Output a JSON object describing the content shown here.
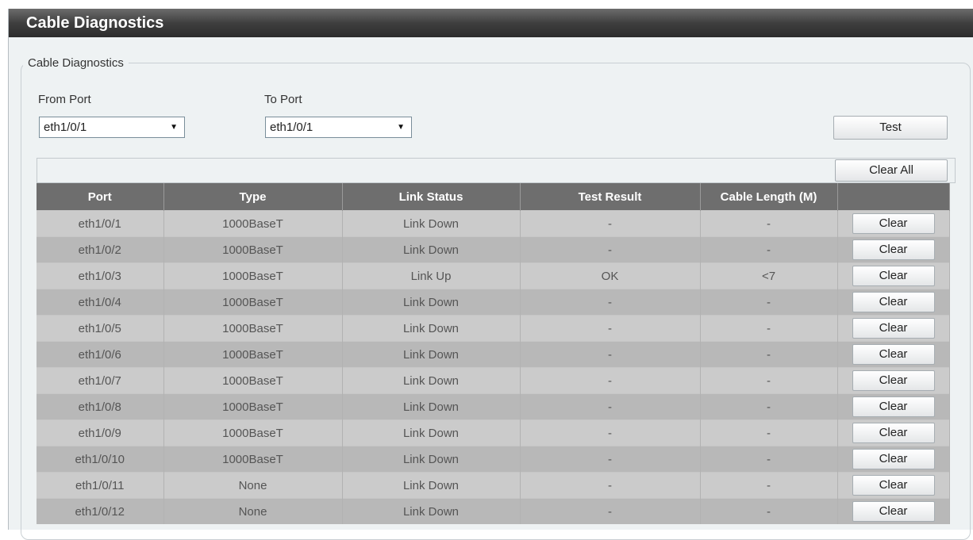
{
  "window": {
    "title": "Cable Diagnostics"
  },
  "group": {
    "legend": "Cable Diagnostics"
  },
  "form": {
    "from_port_label": "From Port",
    "from_port_value": "eth1/0/1",
    "to_port_label": "To Port",
    "to_port_value": "eth1/0/1",
    "test_button": "Test",
    "clear_all_button": "Clear All"
  },
  "table": {
    "headers": [
      "Port",
      "Type",
      "Link Status",
      "Test Result",
      "Cable Length (M)",
      ""
    ],
    "clear_label": "Clear",
    "rows": [
      {
        "port": "eth1/0/1",
        "type": "1000BaseT",
        "link": "Link Down",
        "result": "-",
        "length": "-"
      },
      {
        "port": "eth1/0/2",
        "type": "1000BaseT",
        "link": "Link Down",
        "result": "-",
        "length": "-"
      },
      {
        "port": "eth1/0/3",
        "type": "1000BaseT",
        "link": "Link Up",
        "result": "OK",
        "length": "<7"
      },
      {
        "port": "eth1/0/4",
        "type": "1000BaseT",
        "link": "Link Down",
        "result": "-",
        "length": "-"
      },
      {
        "port": "eth1/0/5",
        "type": "1000BaseT",
        "link": "Link Down",
        "result": "-",
        "length": "-"
      },
      {
        "port": "eth1/0/6",
        "type": "1000BaseT",
        "link": "Link Down",
        "result": "-",
        "length": "-"
      },
      {
        "port": "eth1/0/7",
        "type": "1000BaseT",
        "link": "Link Down",
        "result": "-",
        "length": "-"
      },
      {
        "port": "eth1/0/8",
        "type": "1000BaseT",
        "link": "Link Down",
        "result": "-",
        "length": "-"
      },
      {
        "port": "eth1/0/9",
        "type": "1000BaseT",
        "link": "Link Down",
        "result": "-",
        "length": "-"
      },
      {
        "port": "eth1/0/10",
        "type": "1000BaseT",
        "link": "Link Down",
        "result": "-",
        "length": "-"
      },
      {
        "port": "eth1/0/11",
        "type": "None",
        "link": "Link Down",
        "result": "-",
        "length": "-"
      },
      {
        "port": "eth1/0/12",
        "type": "None",
        "link": "Link Down",
        "result": "-",
        "length": "-"
      }
    ]
  }
}
